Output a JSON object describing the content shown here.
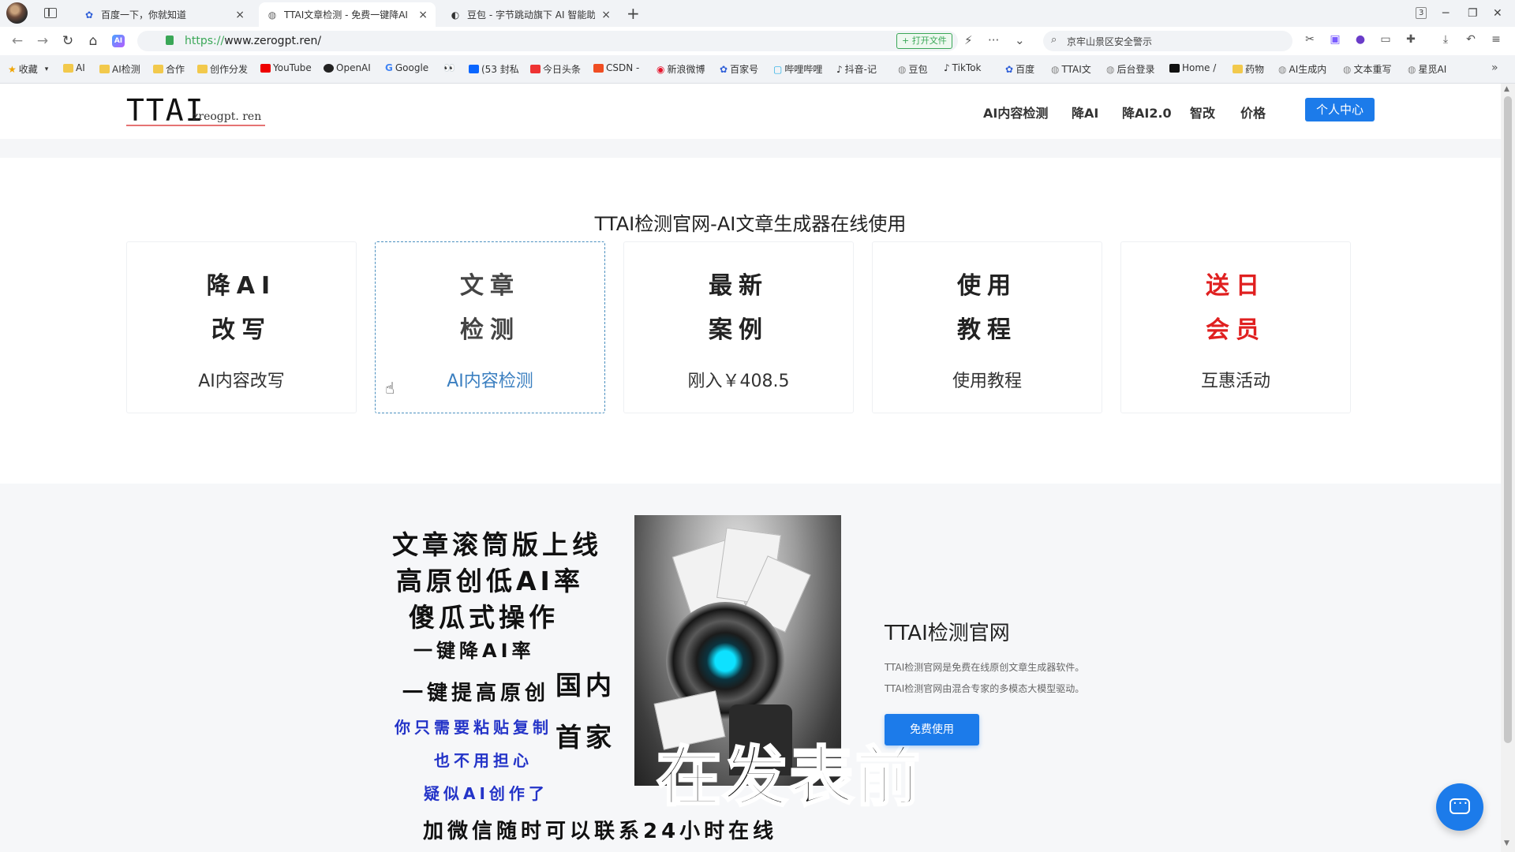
{
  "browser": {
    "tabs": [
      {
        "title": "百度一下，你就知道",
        "active": false,
        "icon": "baidu-paw-icon"
      },
      {
        "title": "TTAI文章检测 - 免费一键降AI",
        "active": true,
        "icon": "globe-icon"
      },
      {
        "title": "豆包 - 字节跳动旗下 AI 智能助",
        "active": false,
        "icon": "doubao-icon"
      }
    ],
    "url_scheme": "https://",
    "url_rest": "www.zerogpt.ren/",
    "open_file_label": "+ 打开文件",
    "search_query": "京牢山景区安全警示",
    "window_badge": "3",
    "bookmarks": [
      "收藏",
      "AI",
      "AI检测",
      "合作",
      "创作分发",
      "YouTube",
      "OpenAI",
      "Google",
      "",
      "(53 封私",
      "今日头条",
      "CSDN -",
      "新浪微博",
      "百家号",
      "哔哩哔哩",
      "抖音-记",
      "豆包",
      "TikTok",
      "百度",
      "TTAI文",
      "后台登录",
      "Home /",
      "药物",
      "AI生成内",
      "文本重写",
      "星觅AI"
    ]
  },
  "header": {
    "logo_main": "TTAI",
    "logo_sub": "zreogpt. ren",
    "nav": [
      "AI内容检测",
      "降AI",
      "降AI2.0",
      "智改",
      "价格"
    ],
    "center_button": "个人中心"
  },
  "section": {
    "title": "TTAI检测官网-AI文章生成器在线使用",
    "cards": [
      {
        "line1": "降AI",
        "line2": "改写",
        "sub": "AI内容改写"
      },
      {
        "line1": "文章",
        "line2": "检测",
        "sub": "AI内容检测"
      },
      {
        "line1": "最新",
        "line2": "案例",
        "sub": "刚入￥408.5"
      },
      {
        "line1": "使用",
        "line2": "教程",
        "sub": "使用教程"
      },
      {
        "line1": "送日",
        "line2": "会员",
        "sub": "互惠活动"
      }
    ]
  },
  "promo": {
    "lines": [
      "文章滚筒版上线",
      "高原创低AI率",
      "傻瓜式操作",
      "一键降AI率",
      "一键提高原创",
      "国内",
      "你只需要粘贴复制",
      "首家",
      "也不用担心",
      "疑似AI创作了",
      "加微信随时可以联系24小时在线"
    ],
    "caption": "在发表前"
  },
  "info": {
    "site_name": "TTAI检测官网",
    "desc1": "TTAI检测官网是免费在线原创文章生成器软件。",
    "desc2": "TTAI检测官网由混合专家的多模态大模型驱动。",
    "free_button": "免费使用"
  },
  "colors": {
    "accent": "#1c7bea",
    "promo_red": "#e02020",
    "promo_blue": "#2434c8"
  }
}
